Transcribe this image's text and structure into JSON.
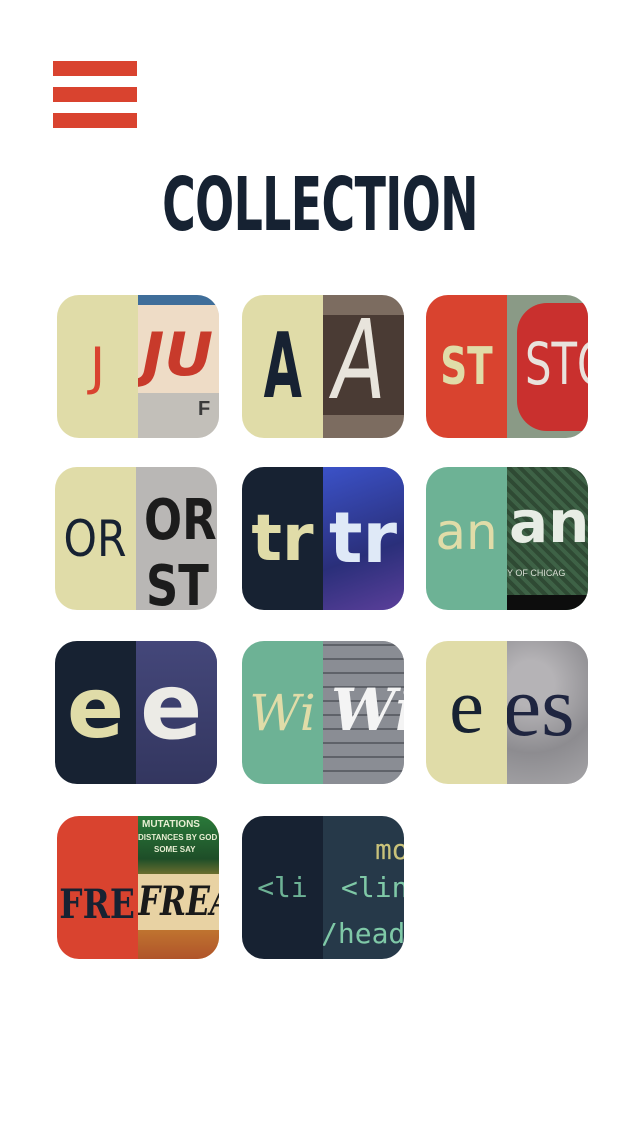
{
  "colors": {
    "accent": "#d9432f",
    "title": "#162232",
    "cream": "#e0dca8",
    "navy": "#172232",
    "teal": "#6db295",
    "red": "#d9432f"
  },
  "menu": {
    "icon": "hamburger-menu-icon"
  },
  "header": {
    "title": "COLLECTION"
  },
  "collection": [
    {
      "id": "j",
      "glyph": "J",
      "photo_text": "JU",
      "photo_sub": "F"
    },
    {
      "id": "a",
      "glyph": "A",
      "photo_text": "A"
    },
    {
      "id": "st",
      "glyph": "ST",
      "photo_text": "STO"
    },
    {
      "id": "or",
      "glyph": "OR",
      "photo_text": "OR",
      "photo_sub": "ST"
    },
    {
      "id": "tr",
      "glyph": "tr",
      "photo_text": "tr"
    },
    {
      "id": "an",
      "glyph": "an",
      "photo_text": "an",
      "photo_sub": "Y OF CHICAG"
    },
    {
      "id": "e1",
      "glyph": "e",
      "photo_text": "e"
    },
    {
      "id": "wi",
      "glyph": "Wi",
      "photo_text": "Wi"
    },
    {
      "id": "e2",
      "glyph": "e",
      "photo_text": "es"
    },
    {
      "id": "fre",
      "glyph": "FRE",
      "photo_text": "FREA",
      "photo_sub": "MUTATIONS",
      "photo_sub2": "DISTANCES BY GOD",
      "photo_sub3": "SOME SAY"
    },
    {
      "id": "li",
      "glyph": "<li",
      "photo_text": "<lin",
      "photo_sub": "mo",
      "photo_sub2": "/head"
    }
  ]
}
